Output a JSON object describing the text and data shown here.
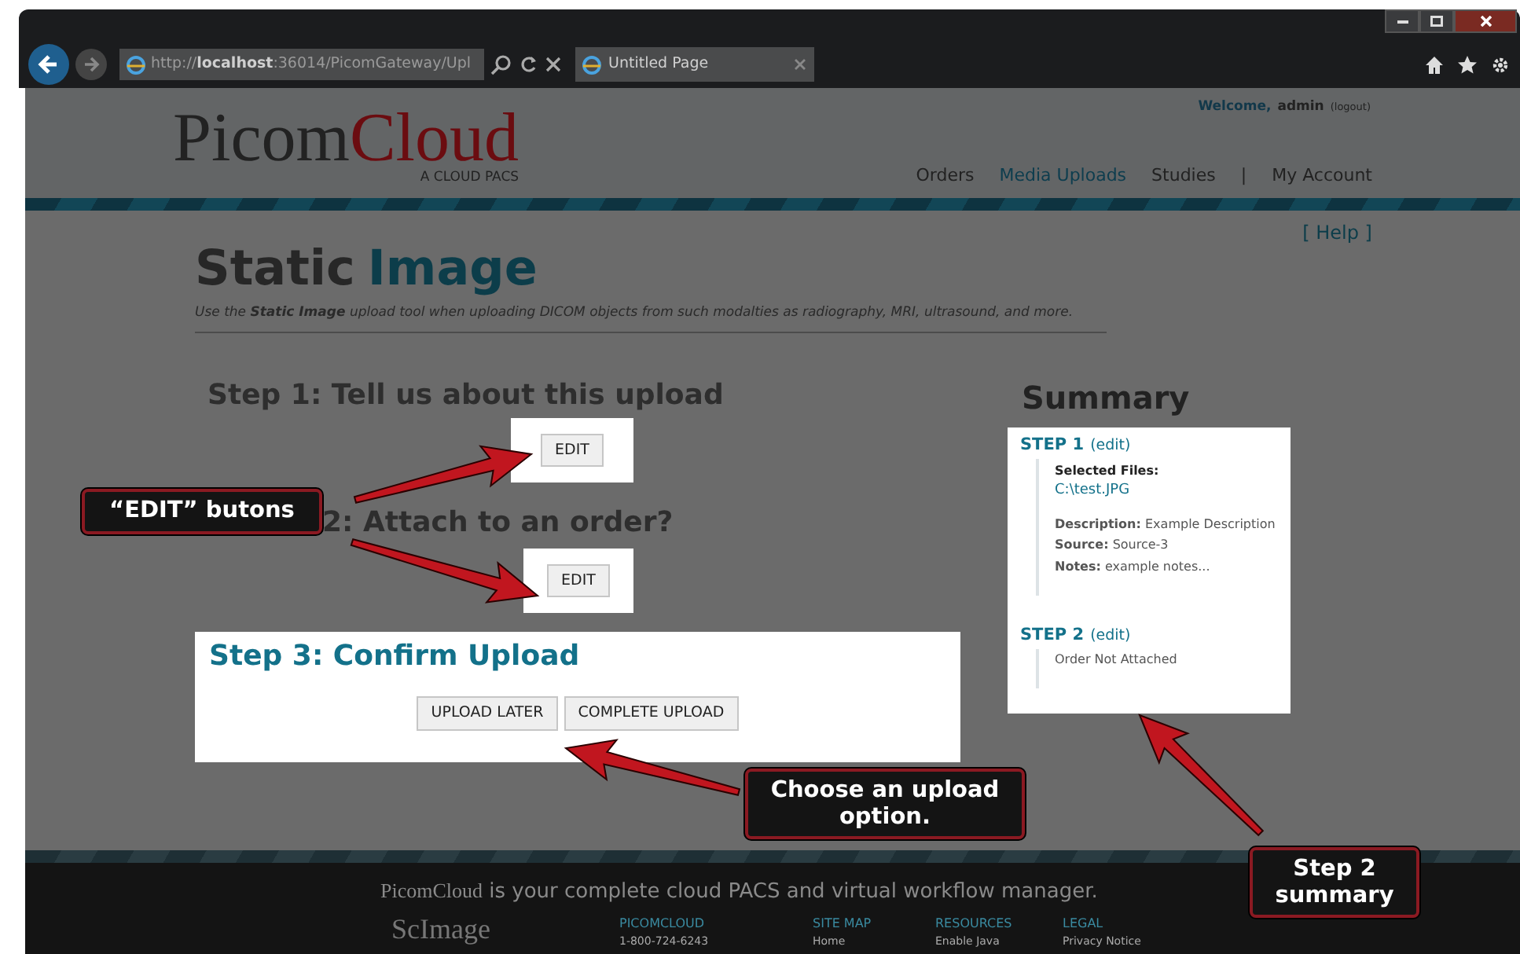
{
  "browser": {
    "address": "http://localhost:36014/PicomGateway/Upl",
    "tab_title": "Untitled Page"
  },
  "header": {
    "logo_part1": "Picom",
    "logo_part2": "Cloud",
    "logo_tagline": "A CLOUD PACS",
    "welcome": "Welcome,",
    "user": "admin",
    "logout": "(logout)",
    "nav": [
      {
        "kind": "link",
        "label": "Orders",
        "selected": false
      },
      {
        "kind": "link",
        "label": "Media Uploads",
        "selected": true
      },
      {
        "kind": "link",
        "label": "Studies",
        "selected": false
      },
      {
        "kind": "separator",
        "label": "|"
      },
      {
        "kind": "link",
        "label": "My Account",
        "selected": false
      }
    ]
  },
  "help": "[ Help ]",
  "title_part1": "Static",
  "title_part2": "Image",
  "subtitle": "Use the **Static Image** upload tool when uploading DICOM objects from such modalties as radiography, MRI, ultrasound, and more.",
  "steps": [
    {
      "heading": "Step 1: Tell us about this upload",
      "buttons": [
        "EDIT"
      ]
    },
    {
      "heading": "2: Attach to an order?",
      "buttons": [
        "EDIT"
      ]
    },
    {
      "heading": "Step 3: Confirm Upload",
      "buttons": [
        "UPLOAD LATER",
        "COMPLETE UPLOAD"
      ],
      "highlighted": true
    }
  ],
  "summary": {
    "title": "Summary",
    "steps": [
      {
        "label": "STEP 1",
        "edit": "(edit)",
        "files_label": "Selected Files:",
        "files": [
          "C:\\test.JPG"
        ],
        "details": [
          {
            "label": "Description:",
            "value": "Example Description"
          },
          {
            "label": "Source:",
            "value": "Source-3"
          },
          {
            "label": "Notes:",
            "value": "example notes..."
          }
        ]
      },
      {
        "label": "STEP 2",
        "edit": "(edit)",
        "details": [
          {
            "value": "Order Not Attached"
          }
        ]
      }
    ]
  },
  "footer": {
    "tagline_brand": "PicomCloud",
    "tagline": "is your complete cloud PACS and virtual workflow manager.",
    "logo": "ScImage",
    "columns": [
      {
        "title": "PICOMCLOUD",
        "line": "1-800-724-6243"
      },
      {
        "title": "SITE MAP",
        "line": "Home"
      },
      {
        "title": "RESOURCES",
        "line": "Enable Java"
      },
      {
        "title": "LEGAL",
        "line": "Privacy Notice"
      }
    ]
  },
  "callouts": [
    {
      "text": "“EDIT” butons"
    },
    {
      "text": "Choose an upload option."
    },
    {
      "text": "Step 2 summary"
    }
  ]
}
